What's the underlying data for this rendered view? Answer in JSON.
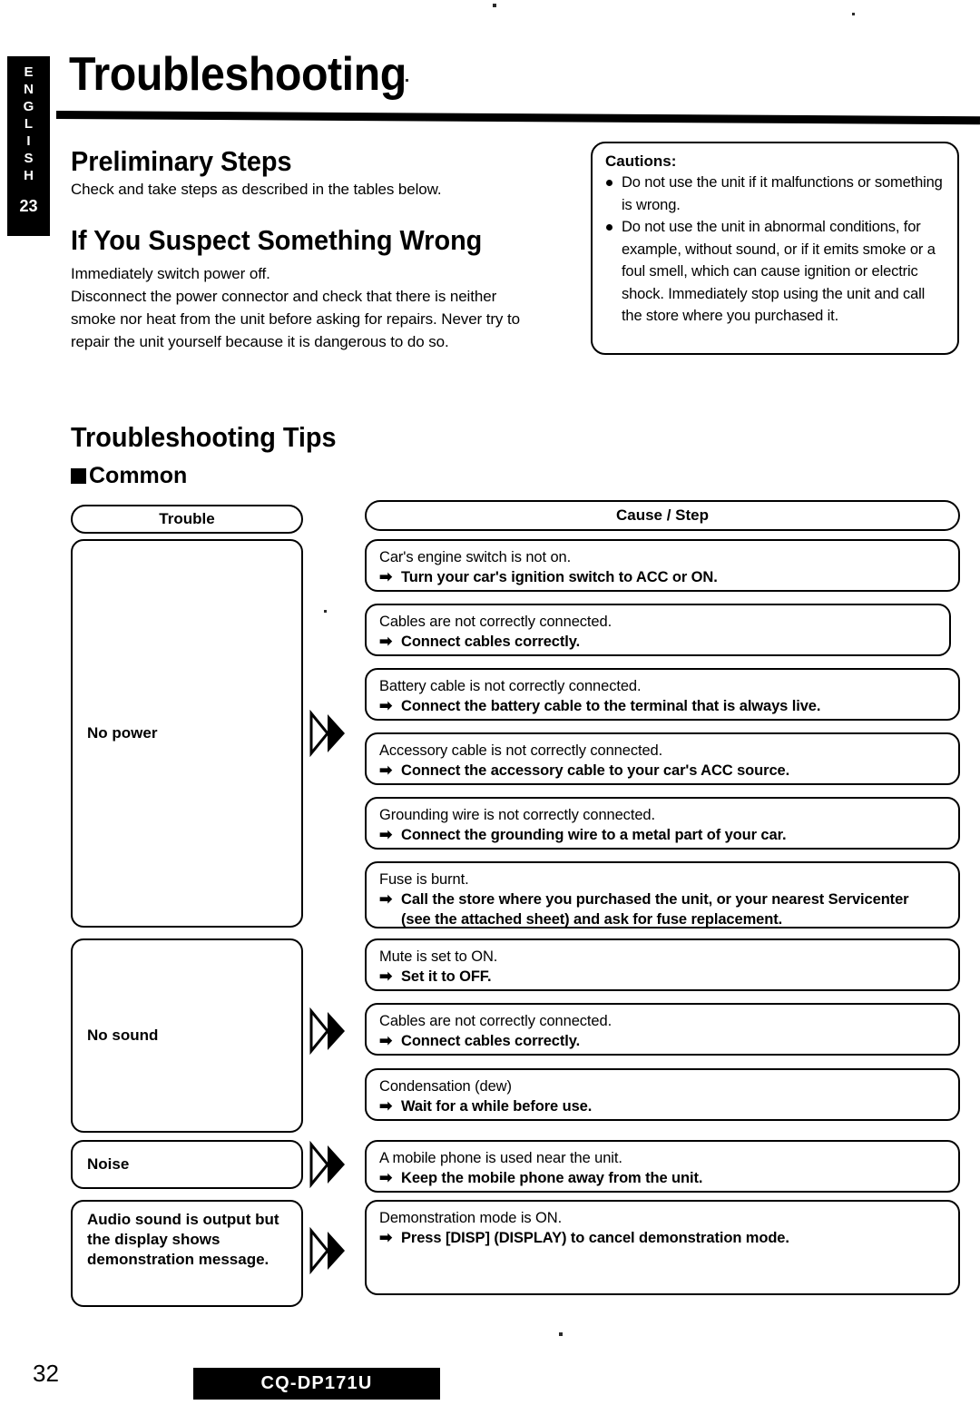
{
  "sidebar": {
    "language_letters": [
      "E",
      "N",
      "G",
      "L",
      "I",
      "S",
      "H"
    ],
    "section_number": "23"
  },
  "header": {
    "title": "Troubleshooting"
  },
  "preliminary": {
    "heading": "Preliminary Steps",
    "body": "Check and take steps as described in the tables below."
  },
  "suspect": {
    "heading": "If You Suspect Something Wrong",
    "body_lines": [
      "Immediately switch power off.",
      "Disconnect the power connector and check that there is neither",
      "smoke nor heat from the unit before asking for repairs. Never try to",
      "repair the unit yourself because it is dangerous to do so."
    ]
  },
  "cautions": {
    "title": "Cautions:",
    "items": [
      "Do not use the unit if it malfunctions or something is wrong.",
      "Do not use the unit in abnormal conditions, for example, without sound, or if it emits smoke or a foul smell, which can cause ignition or electric shock. Immediately stop using the unit and call the store where you purchased it."
    ]
  },
  "tips": {
    "heading": "Troubleshooting Tips",
    "subheading": "Common",
    "columns": {
      "trouble": "Trouble",
      "cause_step": "Cause / Step"
    },
    "arrow_glyph": "➡",
    "troubles": [
      {
        "label": "No power"
      },
      {
        "label": "No sound"
      },
      {
        "label": "Noise"
      },
      {
        "label": "Audio sound is output but the display shows demonstration message."
      }
    ],
    "rows": [
      {
        "cause": "Car's engine switch is not on.",
        "step": "Turn your car's ignition switch to ACC or ON.",
        "step2": ""
      },
      {
        "cause": "Cables are not correctly connected.",
        "step": "Connect cables correctly.",
        "step2": ""
      },
      {
        "cause": "Battery cable is not correctly connected.",
        "step": "Connect the battery cable to the terminal that is always live.",
        "step2": ""
      },
      {
        "cause": "Accessory cable is not correctly connected.",
        "step": "Connect the accessory cable to your car's ACC source.",
        "step2": ""
      },
      {
        "cause": "Grounding wire is not correctly connected.",
        "step": "Connect the grounding wire to a metal part of your car.",
        "step2": ""
      },
      {
        "cause": "Fuse is burnt.",
        "step": "Call the store where you purchased the unit, or your nearest Servicenter",
        "step2": "(see the attached sheet) and ask for fuse replacement."
      },
      {
        "cause": "Mute is set to ON.",
        "step": "Set it to OFF.",
        "step2": ""
      },
      {
        "cause": "Cables are not correctly connected.",
        "step": "Connect cables correctly.",
        "step2": ""
      },
      {
        "cause": "Condensation (dew)",
        "step": "Wait for a while before use.",
        "step2": ""
      },
      {
        "cause": "A mobile phone is used near the unit.",
        "step": "Keep the mobile phone away from the unit.",
        "step2": ""
      },
      {
        "cause": "Demonstration mode is ON.",
        "step": "Press [DISP] (DISPLAY) to cancel demonstration mode.",
        "step2": ""
      }
    ]
  },
  "footer": {
    "page_number": "32",
    "model": "CQ-DP171U"
  },
  "colors": {
    "ink": "#000000",
    "paper": "#ffffff"
  }
}
